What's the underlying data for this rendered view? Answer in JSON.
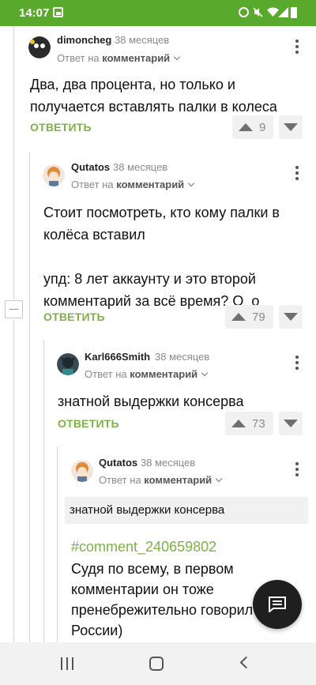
{
  "status_bar": {
    "time": "14:07"
  },
  "comments": [
    {
      "username": "dimoncheg",
      "time_ago": "38 месяцев",
      "reply_prefix": "Ответ на",
      "reply_target": "комментарий",
      "text": [
        "Два, два процента, но только и",
        "получается вставлять палки в колеса"
      ],
      "reply_label": "ОТВЕТИТЬ",
      "score": "9"
    },
    {
      "username": "Qutatos",
      "time_ago": "38 месяцев",
      "reply_prefix": "Ответ на",
      "reply_target": "комментарий",
      "text": [
        "Стоит посмотреть, кто кому палки в",
        "колёса вставил",
        "",
        "упд: 8 лет аккаунту и это второй",
        "комментарий за всё время? О_о"
      ],
      "reply_label": "ОТВЕТИТЬ",
      "score": "79"
    },
    {
      "username": "Karl666Smith",
      "time_ago": "38 месяцев",
      "reply_prefix": "Ответ на",
      "reply_target": "комментарий",
      "text": [
        "знатной выдержки консерва"
      ],
      "reply_label": "ОТВЕТИТЬ",
      "score": "73"
    },
    {
      "username": "Qutatos",
      "time_ago": "38 месяцев",
      "reply_prefix": "Ответ на",
      "reply_target": "комментарий",
      "quote": "знатной выдержки консерва",
      "link": "#comment_240659802",
      "text": [
        "Судя по всему, в первом",
        "комментарии он тоже",
        "пренебрежительно говорил о",
        "России)"
      ]
    }
  ],
  "colors": {
    "accent": "#7cb347",
    "status_bar": "#59a92c",
    "fab": "#1f1f1f"
  },
  "icons": {
    "fab": "comment-icon",
    "nav": [
      "recent-apps-icon",
      "home-icon",
      "back-icon"
    ]
  }
}
